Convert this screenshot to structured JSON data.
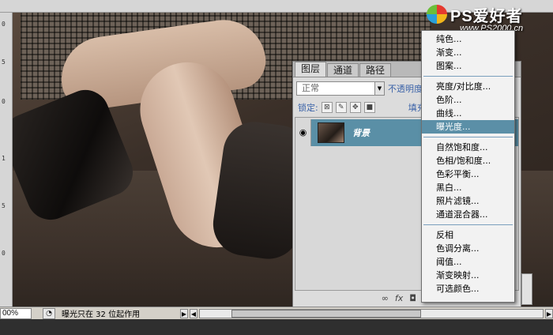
{
  "watermark": {
    "title": "PS爱好者",
    "url": "www.PS2000.cn"
  },
  "ruler": {
    "left_ticks": [
      "0",
      "5",
      "0",
      "1",
      "5",
      "0"
    ]
  },
  "status": {
    "zoom": "00%",
    "message": "曝光只在 32 位起作用",
    "nav_arrow": "▶"
  },
  "layers_panel": {
    "tabs": [
      {
        "label": "图层",
        "active": true
      },
      {
        "label": "通道",
        "active": false
      },
      {
        "label": "路径",
        "active": false
      }
    ],
    "blend_mode": "正常",
    "opacity_label": "不透明度",
    "lock_label": "锁定:",
    "fill_label": "填充",
    "layer": {
      "name": "背景",
      "visible": true
    },
    "footer_icons": [
      "link-icon",
      "fx-icon",
      "mask-icon",
      "adjustment-icon"
    ]
  },
  "menu": {
    "groups": [
      [
        "纯色...",
        "渐变...",
        "图案..."
      ],
      [
        "亮度/对比度...",
        "色阶...",
        "曲线...",
        "曝光度..."
      ],
      [
        "自然饱和度...",
        "色相/饱和度...",
        "色彩平衡...",
        "黑白...",
        "照片滤镜...",
        "通道混合器..."
      ],
      [
        "反相",
        "色调分离...",
        "阈值...",
        "渐变映射...",
        "可选颜色..."
      ]
    ],
    "selected": "曝光度..."
  },
  "colors": {
    "selection": "#5b8fa7",
    "separator": "#7a9fbd",
    "panel_bg": "#dcdcdc"
  }
}
